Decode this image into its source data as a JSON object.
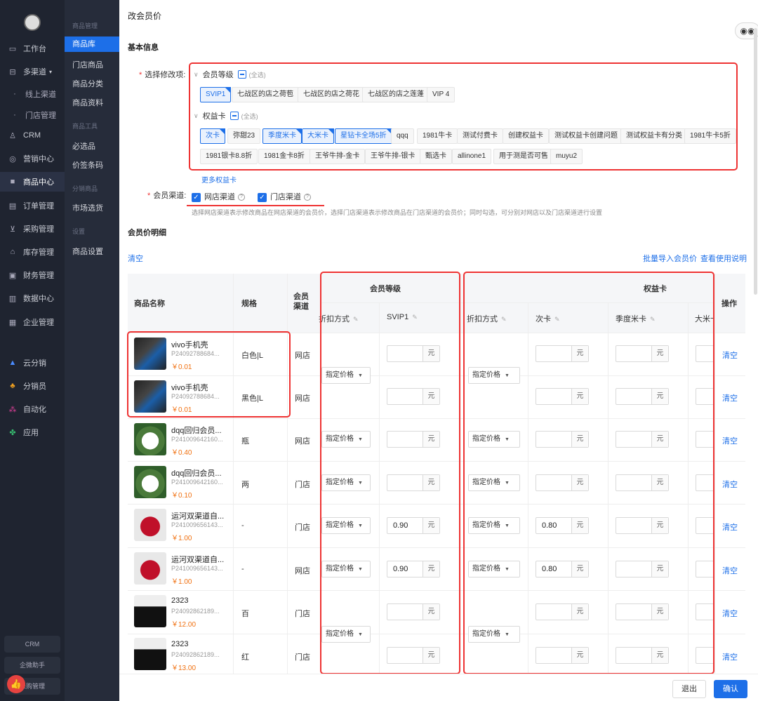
{
  "sidebar": {
    "items": [
      {
        "label": "工作台",
        "icon": "desk-icon"
      },
      {
        "label": "多渠道",
        "icon": "channel-icon"
      },
      {
        "label": "线上渠道",
        "icon": "dot"
      },
      {
        "label": "门店管理",
        "icon": "dot"
      },
      {
        "label": "CRM",
        "icon": "user-icon"
      },
      {
        "label": "营销中心",
        "icon": "target-icon"
      },
      {
        "label": "商品中心",
        "icon": "bag-icon"
      },
      {
        "label": "订单管理",
        "icon": "order-icon"
      },
      {
        "label": "采购管理",
        "icon": "cart-icon"
      },
      {
        "label": "库存管理",
        "icon": "warehouse-icon"
      },
      {
        "label": "财务管理",
        "icon": "finance-icon"
      },
      {
        "label": "数据中心",
        "icon": "chart-icon"
      },
      {
        "label": "企业管理",
        "icon": "company-icon"
      },
      {
        "label": "云分销",
        "icon": "cloud-icon"
      },
      {
        "label": "分销员",
        "icon": "team-icon"
      },
      {
        "label": "自动化",
        "icon": "auto-icon"
      },
      {
        "label": "应用",
        "icon": "apps-icon"
      }
    ],
    "bottom": [
      "CRM",
      "企微助手",
      "采购管理"
    ]
  },
  "subnav": {
    "groups": [
      {
        "title": "商品管理",
        "items": [
          "商品库",
          "门店商品",
          "商品分类",
          "商品资料"
        ]
      },
      {
        "title": "商品工具",
        "items": [
          "必选品",
          "价签条码"
        ]
      },
      {
        "title": "分销商品",
        "items": [
          "市场选货"
        ]
      },
      {
        "title": "设置",
        "items": [
          "商品设置"
        ]
      }
    ]
  },
  "page": {
    "title": "改会员价",
    "basic_info": "基本信息",
    "detail_title": "会员价明细"
  },
  "form": {
    "select_label": "选择修改项:",
    "member_level": {
      "label": "会员等级",
      "all": "(全选)",
      "tags": [
        "SVIP1",
        "七战区的店之荷苞",
        "七战区的店之荷花",
        "七战区的店之莲蓬",
        "VIP 4"
      ]
    },
    "rights_card": {
      "label": "权益卡",
      "all": "(全选)",
      "tags_row1": [
        "次卡",
        "弥甜23",
        "季度米卡",
        "大米卡",
        "星钻卡全场5折",
        "qqq",
        "1981牛卡",
        "测试付费卡",
        "创建权益卡",
        "测试权益卡创建问题",
        "测试权益卡有分类",
        "1981牛卡5折"
      ],
      "tags_row2": [
        "1981银卡8.8折",
        "1981金卡8折",
        "王爷牛排-金卡",
        "王爷牛排-银卡",
        "甄选卡",
        "allinone1",
        "用于测是否可售",
        "muyu2"
      ]
    },
    "more_cards": "更多权益卡",
    "channel_label": "会员渠道:",
    "channels": [
      "网店渠道",
      "门店渠道"
    ],
    "hint": "选择网店渠道表示修改商品在网店渠道的会员价，选择门店渠道表示修改商品在门店渠道的会员价；同时勾选，可分别对网店以及门店渠道进行设置"
  },
  "toolbar": {
    "clear": "清空",
    "batch_import": "批量导入会员价",
    "view_help": "查看使用说明"
  },
  "table": {
    "headers": {
      "name": "商品名称",
      "spec": "规格",
      "channel": "会员\n渠道",
      "member_group": "会员等级",
      "rights_group": "权益卡",
      "op": "操作",
      "discount": "折扣方式",
      "svip1": "SVIP1",
      "discount2": "折扣方式",
      "ci_card": "次卡",
      "quarter_card": "季度米卡",
      "rice_card": "大米卡"
    },
    "unit": "元",
    "select_value": "指定价格",
    "op_label": "清空",
    "rows": [
      {
        "name": "vivo手机壳",
        "code": "P24092788684...",
        "price": "￥0.01",
        "spec": "白色|L",
        "channel": "网店",
        "svip1": "",
        "ci": ""
      },
      {
        "name": "vivo手机壳",
        "code": "P24092788684...",
        "price": "￥0.01",
        "spec": "黑色|L",
        "channel": "网店",
        "svip1": "",
        "ci": ""
      },
      {
        "name": "dqq回归会员...",
        "code": "P241009642160...",
        "price": "￥0.40",
        "spec": "瓶",
        "channel": "网店",
        "svip1": "",
        "ci": ""
      },
      {
        "name": "dqq回归会员...",
        "code": "P241009642160...",
        "price": "￥0.10",
        "spec": "两",
        "channel": "门店",
        "svip1": "",
        "ci": ""
      },
      {
        "name": "运河双渠道自...",
        "code": "P241009656143...",
        "price": "￥1.00",
        "spec": "-",
        "channel": "门店",
        "svip1": "0.90",
        "ci": "0.80"
      },
      {
        "name": "运河双渠道自...",
        "code": "P241009656143...",
        "price": "￥1.00",
        "spec": "-",
        "channel": "网店",
        "svip1": "0.90",
        "ci": "0.80"
      },
      {
        "name": "2323",
        "code": "P24092862189...",
        "price": "￥12.00",
        "spec": "百",
        "channel": "门店",
        "svip1": "",
        "ci": ""
      },
      {
        "name": "2323",
        "code": "P24092862189...",
        "price": "￥13.00",
        "spec": "红",
        "channel": "门店",
        "svip1": "",
        "ci": ""
      }
    ]
  },
  "footer": {
    "exit": "退出",
    "confirm": "确认"
  },
  "colors": {
    "primary": "#1d6fe8",
    "sidebar": "#1f2430",
    "highlight": "#e33",
    "price": "#f07010"
  }
}
